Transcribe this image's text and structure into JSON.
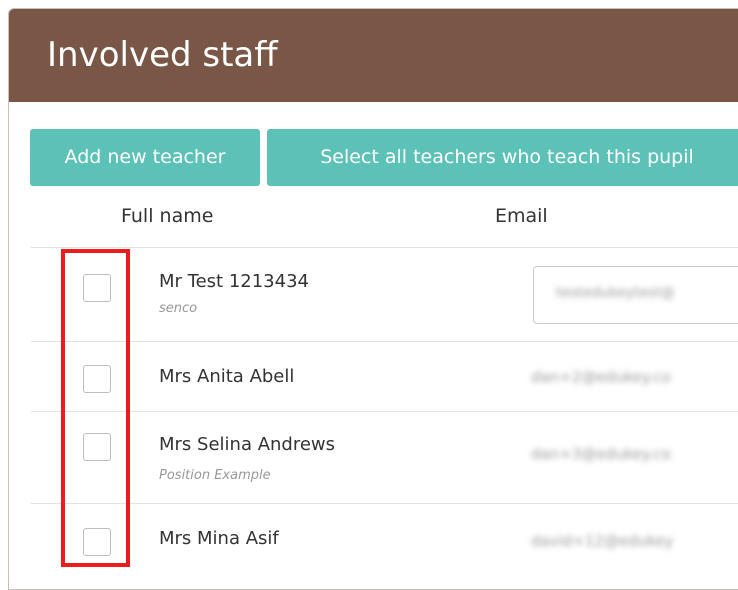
{
  "panel": {
    "title": "Involved staff"
  },
  "toolbar": {
    "add_teacher_label": "Add new teacher",
    "select_all_label": "Select all teachers who teach this pupil"
  },
  "table": {
    "headers": {
      "full_name": "Full name",
      "email": "Email"
    },
    "rows": [
      {
        "name": "Mr Test 1213434",
        "position": "senco",
        "email": "testedukeytest@",
        "checked": false
      },
      {
        "name": "Mrs Anita Abell",
        "position": "",
        "email": "dan+2@edukey.co",
        "checked": false
      },
      {
        "name": "Mrs Selina Andrews",
        "position": "Position Example",
        "email": "dan+3@edukey.co",
        "checked": false
      },
      {
        "name": "Mrs Mina Asif",
        "position": "",
        "email": "david+12@edukey",
        "checked": false
      }
    ]
  },
  "colors": {
    "header_bg": "#7a5647",
    "button_bg": "#5cc2b8",
    "highlight": "#ee1b1b"
  }
}
